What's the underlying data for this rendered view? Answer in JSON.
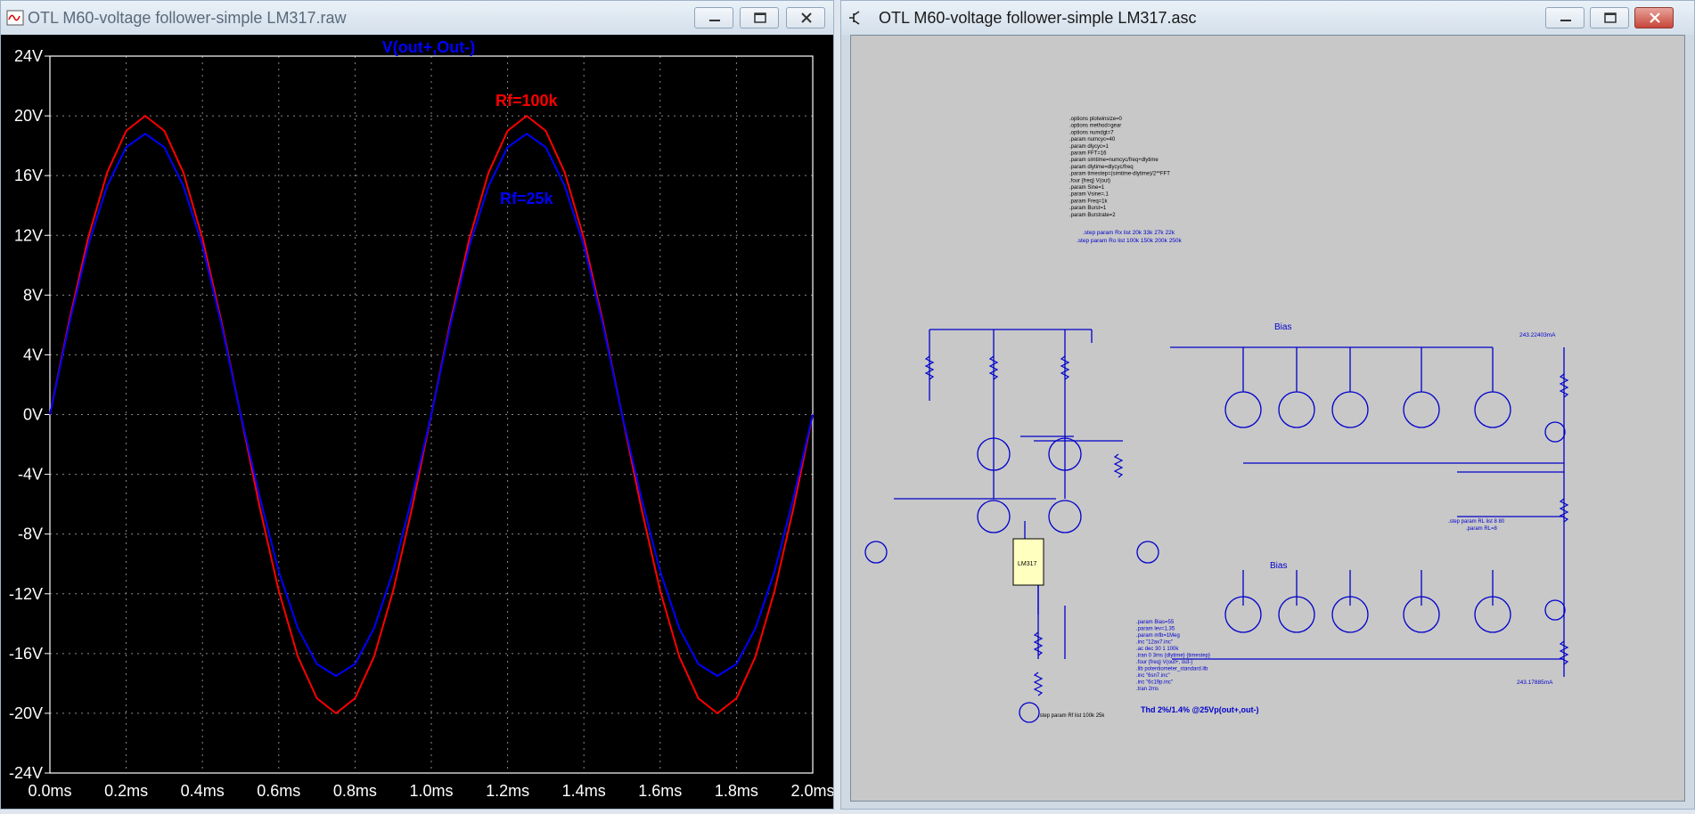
{
  "left_window": {
    "title": "OTL M60-voltage follower-simple LM317.raw",
    "plot": {
      "trace_title": "V(out+,Out-)",
      "labels": {
        "rf100": "Rf=100k",
        "rf25": "Rf=25k"
      }
    }
  },
  "right_window": {
    "title": "OTL M60-voltage follower-simple LM317.asc",
    "directives": [
      ".options plotwinsize=0",
      ".options method=gear",
      ".options numdgt=7",
      ".param numcyc=40",
      ".param dlycyc=1",
      ".param FFT=16",
      ".param simtime=numcyc/freq+dlytime",
      ".param dlytime=dlycyc/freq",
      ".param timestep=(simtime-dlytime)/2**FFT",
      ".four {freq} V(out)",
      ".param Sine=1",
      ".param Vsine=.1",
      ".param Freq=1k",
      ".param Burst=1",
      ".param Burstrate=2"
    ],
    "step_rx": ".step param Rx list 20k 33k 27k 22k",
    "step_ro": ".step param Ro list 100k 150k 200k 250k",
    "params": [
      ".param Bias=55",
      ".param lev=1.35",
      ".param mfb=1Meg",
      ".inc \"12ax7.inc\"",
      ".ac dec 30 1 100k",
      ".tran 0 3ms {dlytime} {timestep}",
      ".four {freq} V(out+, out-)",
      ".lib potentiometer_standard.lib",
      ".inc \"6sn7.inc\"",
      ".inc \"6c19p.inc\"",
      ".tran 2ms"
    ],
    "step_rf": ".step param Rf list 100k 25k",
    "thd": "Thd 2%/1.4% @25Vp(out+,out-)",
    "step_rl": ".step param RL list 8 80",
    "param_rl": ".param RL=8",
    "bias_label": "Bias",
    "lm317_label": "LM317",
    "current_top": "243.22403mA",
    "current_bottom": "243.17885mA"
  },
  "chart_data": {
    "type": "line",
    "title": "V(out+,Out-)",
    "xlabel": "",
    "ylabel": "",
    "xlim": [
      0,
      2.0
    ],
    "ylim": [
      -24,
      24
    ],
    "x_ticks": [
      "0.0ms",
      "0.2ms",
      "0.4ms",
      "0.6ms",
      "0.8ms",
      "1.0ms",
      "1.2ms",
      "1.4ms",
      "1.6ms",
      "1.8ms",
      "2.0ms"
    ],
    "y_ticks": [
      "24V",
      "20V",
      "16V",
      "12V",
      "8V",
      "4V",
      "0V",
      "-4V",
      "-8V",
      "-12V",
      "-16V",
      "-20V",
      "-24V"
    ],
    "grid": true,
    "series": [
      {
        "name": "Rf=100k",
        "color": "#ff0000",
        "x": [
          0,
          0.05,
          0.1,
          0.15,
          0.2,
          0.25,
          0.3,
          0.35,
          0.4,
          0.45,
          0.5,
          0.55,
          0.6,
          0.65,
          0.7,
          0.75,
          0.8,
          0.85,
          0.9,
          0.95,
          1.0,
          1.05,
          1.1,
          1.15,
          1.2,
          1.25,
          1.3,
          1.35,
          1.4,
          1.45,
          1.5,
          1.55,
          1.6,
          1.65,
          1.7,
          1.75,
          1.8,
          1.85,
          1.9,
          1.95,
          2.0
        ],
        "y": [
          0,
          6.2,
          11.8,
          16.2,
          19.0,
          20.0,
          19.0,
          16.2,
          11.8,
          6.2,
          0,
          -6.2,
          -11.8,
          -16.2,
          -19.0,
          -20.0,
          -19.0,
          -16.2,
          -11.8,
          -6.2,
          0,
          6.2,
          11.8,
          16.2,
          19.0,
          20.0,
          19.0,
          16.2,
          11.8,
          6.2,
          0,
          -6.2,
          -11.8,
          -16.2,
          -19.0,
          -20.0,
          -19.0,
          -16.2,
          -11.8,
          -6.2,
          0
        ]
      },
      {
        "name": "Rf=25k",
        "color": "#0000ff",
        "x": [
          0,
          0.05,
          0.1,
          0.15,
          0.2,
          0.25,
          0.3,
          0.35,
          0.4,
          0.45,
          0.5,
          0.55,
          0.6,
          0.65,
          0.7,
          0.75,
          0.8,
          0.85,
          0.9,
          0.95,
          1.0,
          1.05,
          1.1,
          1.15,
          1.2,
          1.25,
          1.3,
          1.35,
          1.4,
          1.45,
          1.5,
          1.55,
          1.6,
          1.65,
          1.7,
          1.75,
          1.8,
          1.85,
          1.9,
          1.95,
          2.0
        ],
        "y": [
          0,
          6.0,
          11.3,
          15.3,
          17.9,
          18.8,
          17.9,
          15.3,
          11.3,
          6.0,
          0,
          -5.5,
          -10.5,
          -14.3,
          -16.7,
          -17.5,
          -16.7,
          -14.3,
          -10.5,
          -5.5,
          0,
          6.0,
          11.3,
          15.3,
          17.9,
          18.8,
          17.9,
          15.3,
          11.3,
          6.0,
          0,
          -5.5,
          -10.5,
          -14.3,
          -16.7,
          -17.5,
          -16.7,
          -14.3,
          -10.5,
          -5.5,
          0
        ]
      }
    ]
  }
}
